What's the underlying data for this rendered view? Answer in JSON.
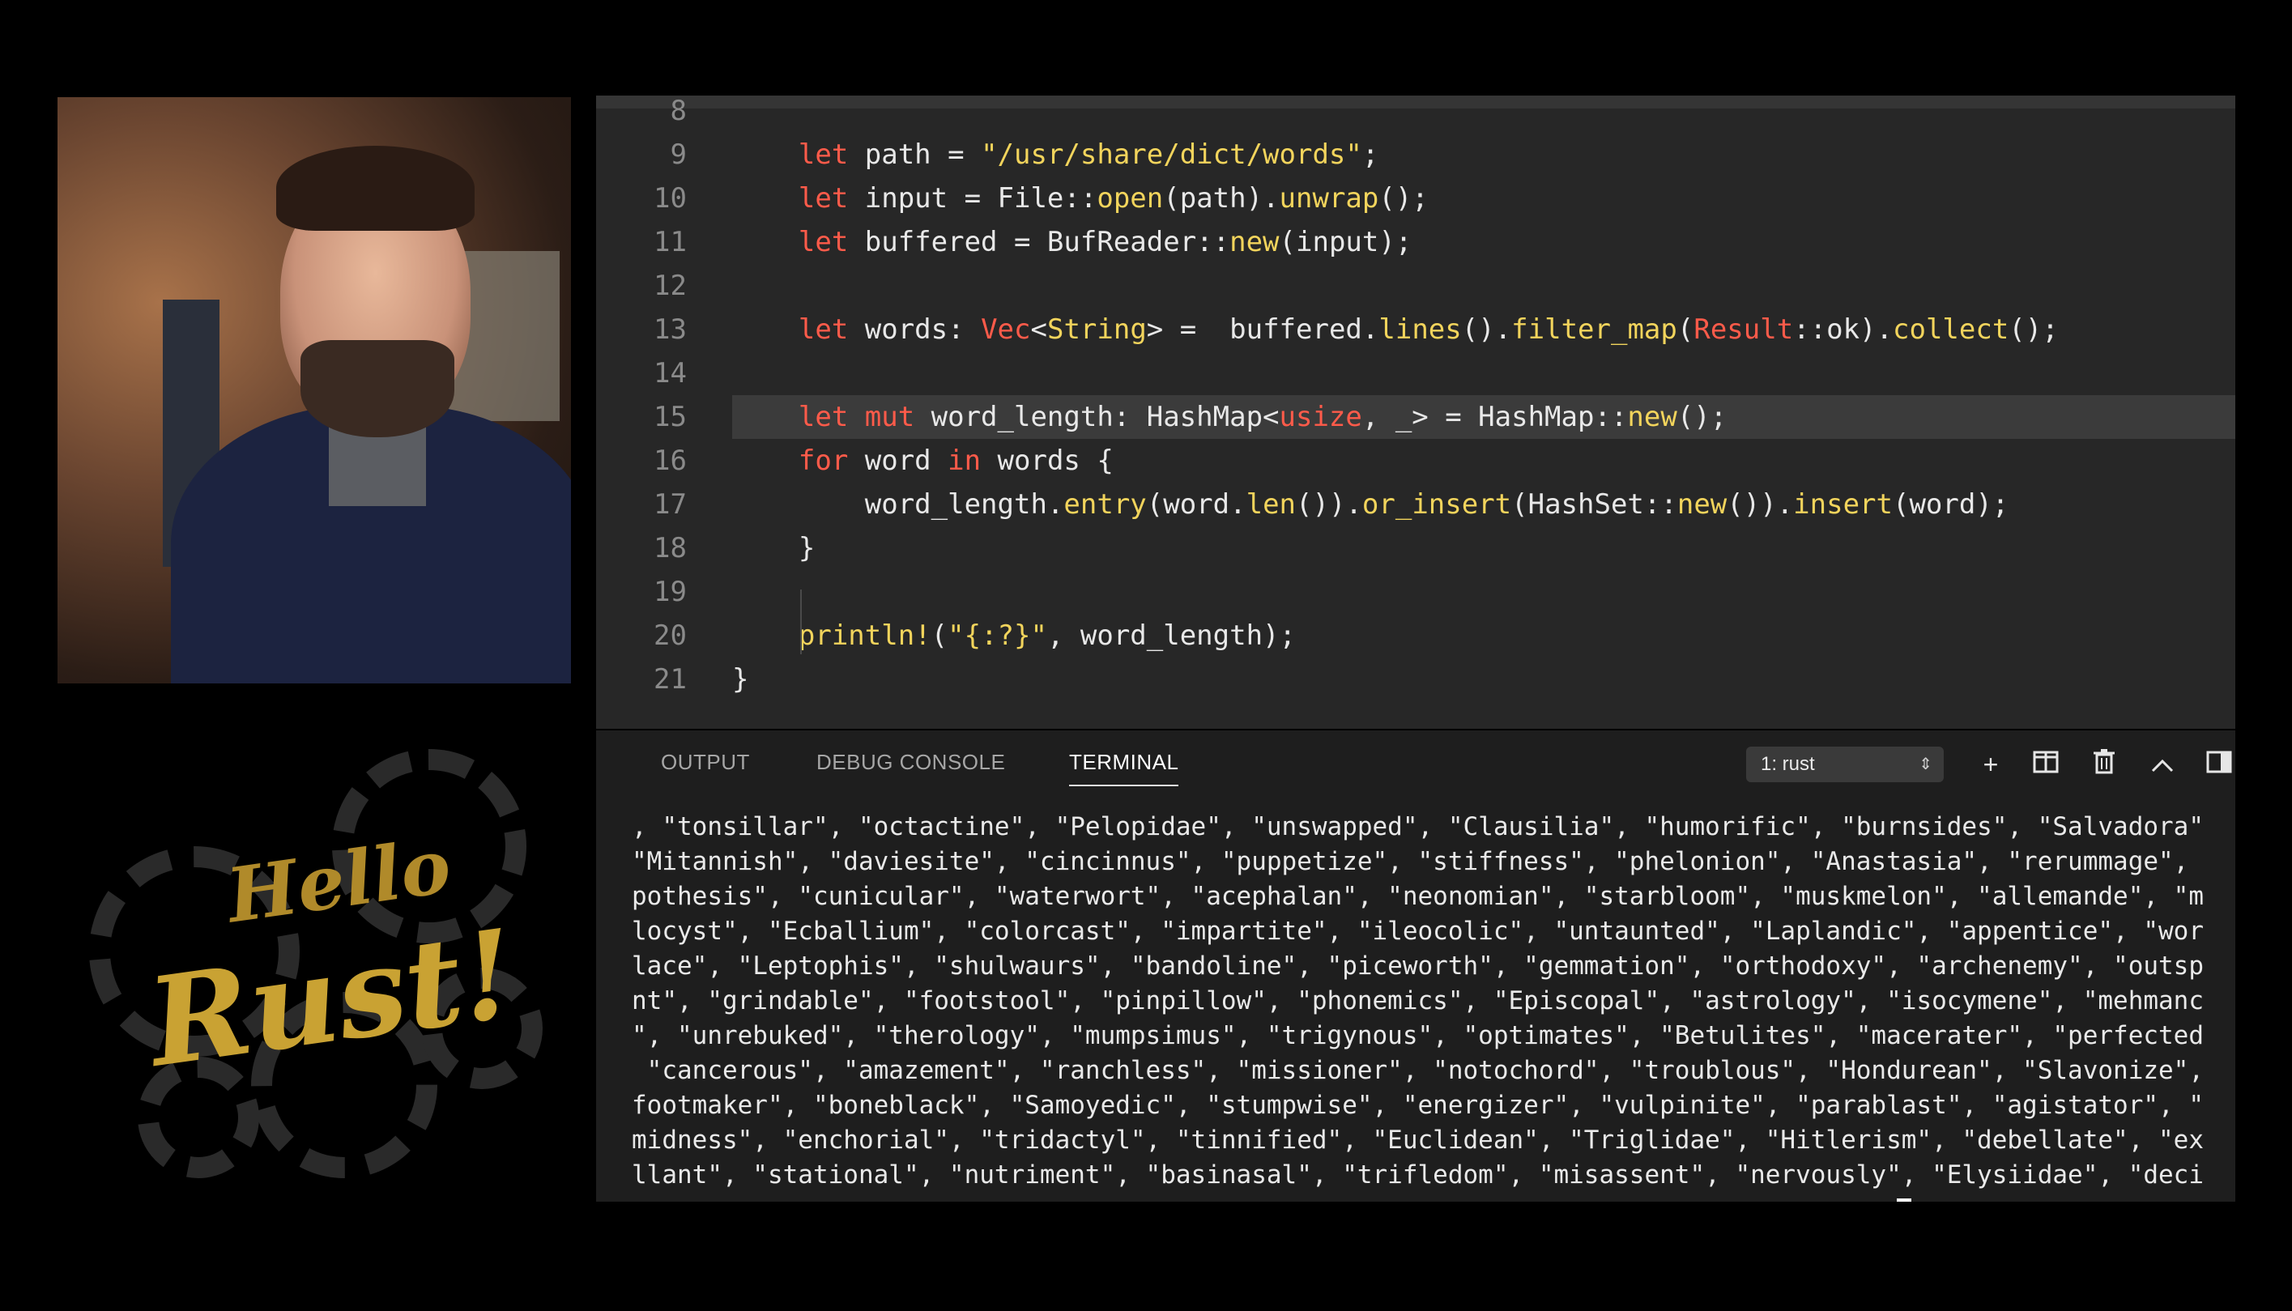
{
  "editor": {
    "lines": [
      {
        "n": "8",
        "code": []
      },
      {
        "n": "9",
        "code": [
          [
            "kw",
            "    let "
          ],
          [
            "",
            "path = "
          ],
          [
            "str",
            "\"/usr/share/dict/words\""
          ],
          [
            "",
            ";"
          ]
        ]
      },
      {
        "n": "10",
        "code": [
          [
            "kw",
            "    let "
          ],
          [
            "",
            "input = File::"
          ],
          [
            "fn",
            "open"
          ],
          [
            "",
            "(path)."
          ],
          [
            "fn",
            "unwrap"
          ],
          [
            "",
            "();"
          ]
        ]
      },
      {
        "n": "11",
        "code": [
          [
            "kw",
            "    let "
          ],
          [
            "",
            "buffered = BufReader::"
          ],
          [
            "fn",
            "new"
          ],
          [
            "",
            "(input);"
          ]
        ]
      },
      {
        "n": "12",
        "code": []
      },
      {
        "n": "13",
        "code": [
          [
            "kw",
            "    let "
          ],
          [
            "",
            "words: "
          ],
          [
            "kw",
            "Vec"
          ],
          [
            "",
            "<"
          ],
          [
            "ty",
            "String"
          ],
          [
            "",
            "> =  buffered."
          ],
          [
            "fn",
            "lines"
          ],
          [
            "",
            "()."
          ],
          [
            "fn",
            "filter_map"
          ],
          [
            "",
            "("
          ],
          [
            "kw",
            "Result"
          ],
          [
            "",
            "::ok)."
          ],
          [
            "fn",
            "collect"
          ],
          [
            "",
            "();"
          ]
        ]
      },
      {
        "n": "14",
        "code": []
      },
      {
        "n": "15",
        "code": [
          [
            "kw",
            "    let mut "
          ],
          [
            "",
            "word_length: HashMap<"
          ],
          [
            "kw",
            "usize"
          ],
          [
            "",
            ", _> = HashMap::"
          ],
          [
            "fn",
            "new"
          ],
          [
            "",
            "();"
          ]
        ],
        "highlight": true
      },
      {
        "n": "16",
        "code": [
          [
            "kw",
            "    for "
          ],
          [
            "",
            "word "
          ],
          [
            "kw",
            "in "
          ],
          [
            "",
            "words {"
          ]
        ]
      },
      {
        "n": "17",
        "code": [
          [
            "",
            "        word_length."
          ],
          [
            "fn",
            "entry"
          ],
          [
            "",
            "(word."
          ],
          [
            "fn",
            "len"
          ],
          [
            "",
            "())."
          ],
          [
            "fn",
            "or_insert"
          ],
          [
            "",
            "(HashSet::"
          ],
          [
            "fn",
            "new"
          ],
          [
            "",
            "())."
          ],
          [
            "fn",
            "insert"
          ],
          [
            "",
            "(word);"
          ]
        ]
      },
      {
        "n": "18",
        "code": [
          [
            "",
            "    }"
          ]
        ]
      },
      {
        "n": "19",
        "code": []
      },
      {
        "n": "20",
        "code": [
          [
            "fn",
            "    println!"
          ],
          [
            "",
            "("
          ],
          [
            "str",
            "\"{:?}\""
          ],
          [
            "",
            ", word_length);"
          ]
        ]
      },
      {
        "n": "21",
        "code": [
          [
            "",
            "}"
          ]
        ]
      }
    ]
  },
  "panel": {
    "tabs": {
      "output": "OUTPUT",
      "debug": "DEBUG CONSOLE",
      "terminal": "TERMINAL"
    },
    "terminal_select": "1: rust",
    "icons": [
      "plus-icon",
      "split-icon",
      "trash-icon",
      "chevron-up-icon",
      "panel-icon"
    ],
    "terminal_lines": [
      ", \"tonsillar\", \"octactine\", \"Pelopidae\", \"unswapped\", \"Clausilia\", \"humorific\", \"burnsides\", \"Salvadora\"",
      "\"Mitannish\", \"daviesite\", \"cincinnus\", \"puppetize\", \"stiffness\", \"phelonion\", \"Anastasia\", \"rerummage\",",
      "pothesis\", \"cunicular\", \"waterwort\", \"acephalan\", \"neonomian\", \"starbloom\", \"muskmelon\", \"allemande\", \"m",
      "locyst\", \"Ecballium\", \"colorcast\", \"impartite\", \"ileocolic\", \"untaunted\", \"Laplandic\", \"appentice\", \"wor",
      "lace\", \"Leptophis\", \"shulwaurs\", \"bandoline\", \"piceworth\", \"gemmation\", \"orthodoxy\", \"archenemy\", \"outsp",
      "nt\", \"grindable\", \"footstool\", \"pinpillow\", \"phonemics\", \"Episcopal\", \"astrology\", \"isocymene\", \"mehmanc",
      "\", \"unrebuked\", \"therology\", \"mumpsimus\", \"trigynous\", \"optimates\", \"Betulites\", \"macerater\", \"perfected",
      " \"cancerous\", \"amazement\", \"ranchless\", \"missioner\", \"notochord\", \"troublous\", \"Hondurean\", \"Slavonize\",",
      "footmaker\", \"boneblack\", \"Samoyedic\", \"stumpwise\", \"energizer\", \"vulpinite\", \"parablast\", \"agistator\", \"",
      "midness\", \"enchorial\", \"tridactyl\", \"tinnified\", \"Euclidean\", \"Triglidae\", \"Hitlerism\", \"debellate\", \"ex",
      "llant\", \"stational\", \"nutriment\", \"basinasal\", \"trifledom\", \"misassent\", \"nervously\", \"Elysiidae\", \"deci"
    ]
  },
  "logo": {
    "hello": "Hello",
    "rust": "Rust!"
  },
  "colors": {
    "keyword": "#ff5b4a",
    "function": "#f2d45c",
    "logo_gold": "#c9a233"
  }
}
